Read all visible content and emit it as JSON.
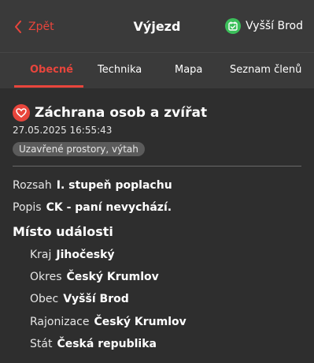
{
  "header": {
    "back_label": "Zpět",
    "title": "Výjezd",
    "station": "Vyšší Brod"
  },
  "tabs": [
    {
      "label": "Obecné",
      "active": true
    },
    {
      "label": "Technika",
      "active": false
    },
    {
      "label": "Mapa",
      "active": false
    },
    {
      "label": "Seznam členů",
      "active": false
    }
  ],
  "incident": {
    "type_title": "Záchrana osob a zvířat",
    "timestamp": "27.05.2025 16:55:43",
    "badge": "Uzavřené prostory, výtah"
  },
  "details": {
    "rozsah": {
      "label": "Rozsah",
      "value": "I. stupeň poplachu"
    },
    "popis": {
      "label": "Popis",
      "value": "CK - paní nevychází."
    }
  },
  "location": {
    "title": "Místo události",
    "kraj": {
      "label": "Kraj",
      "value": "Jihočeský"
    },
    "okres": {
      "label": "Okres",
      "value": "Český Krumlov"
    },
    "obec": {
      "label": "Obec",
      "value": "Vyšší Brod"
    },
    "rajonizace": {
      "label": "Rajonizace",
      "value": "Český Krumlov"
    },
    "stat": {
      "label": "Stát",
      "value": "Česká republika"
    }
  },
  "colors": {
    "accent": "#e8453c",
    "background": "#2e2e2e",
    "header": "#3a3a3a",
    "station_icon": "#3bbf5a"
  },
  "icons": {
    "back": "chevron-left-icon",
    "station": "calendar-check-icon",
    "incident": "heart-icon"
  }
}
